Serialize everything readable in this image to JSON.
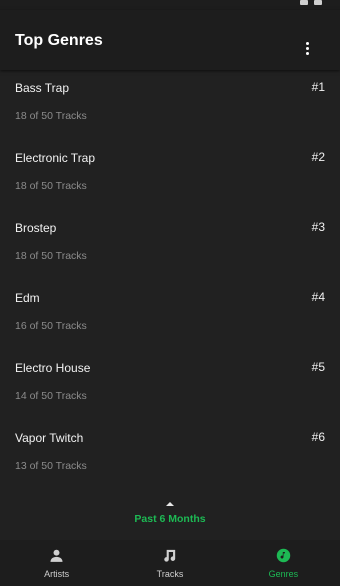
{
  "header": {
    "title": "Top Genres"
  },
  "genres": [
    {
      "name": "Bass Trap",
      "count": "18 of 50 Tracks",
      "rank": "#1"
    },
    {
      "name": "Electronic Trap",
      "count": "18 of 50 Tracks",
      "rank": "#2"
    },
    {
      "name": "Brostep",
      "count": "18 of 50 Tracks",
      "rank": "#3"
    },
    {
      "name": "Edm",
      "count": "16 of 50 Tracks",
      "rank": "#4"
    },
    {
      "name": "Electro House",
      "count": "14 of 50 Tracks",
      "rank": "#5"
    },
    {
      "name": "Vapor Twitch",
      "count": "13 of 50 Tracks",
      "rank": "#6"
    }
  ],
  "time_range": {
    "label": "Past 6 Months"
  },
  "nav": {
    "items": [
      {
        "label": "Artists",
        "icon": "person-icon"
      },
      {
        "label": "Tracks",
        "icon": "music-note-icon"
      },
      {
        "label": "Genres",
        "icon": "genre-icon"
      }
    ],
    "active": "Genres"
  },
  "colors": {
    "accent": "#1db954",
    "background": "#212121",
    "bar": "#1d1d1d",
    "muted_text": "#8c8c8c"
  }
}
